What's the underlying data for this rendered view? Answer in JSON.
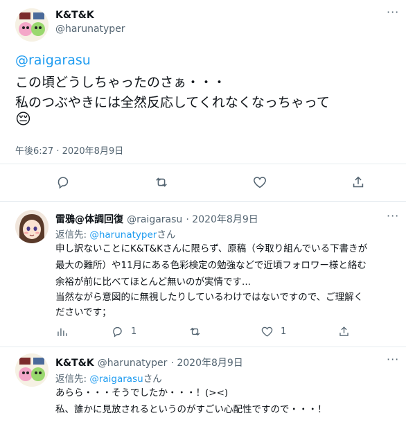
{
  "main_tweet": {
    "author_name": "K&T&K",
    "author_handle": "@harunatyper",
    "mention": "@raigarasu",
    "lines": [
      "この頃どうしちゃったのさぁ・・・",
      "私のつぶやきには全然反応してくれなくなっちゃって"
    ],
    "emoji": "😔",
    "timestamp": "午後6:27 · 2020年8月9日"
  },
  "reply1": {
    "author_name": "雷鴉@体調回復",
    "author_handle": "@raigarasu",
    "date": "2020年8月9日",
    "replying_prefix": "返信先: ",
    "replying_to": "@harunatyper",
    "replying_suffix": "さん",
    "lines": [
      "申し訳ないことにK&T&Kさんに限らず、原稿（今取り組んでいる下書きが",
      "最大の難所）や11月にある色彩検定の勉強などで近頃フォロワー様と絡む",
      "余裕が前に比べてほとんど無いのが実情です...",
      "当然ながら意図的に無視したりしているわけではないですので、ご理解く",
      "ださいです；"
    ],
    "reply_count": "1",
    "like_count": "1"
  },
  "reply2": {
    "author_name": "K&T&K",
    "author_handle": "@harunatyper",
    "date": "2020年8月9日",
    "replying_prefix": "返信先: ",
    "replying_to": "@raigarasu",
    "replying_suffix": "さん",
    "lines": [
      "あらら・・・そうでしたか・・・！(><)",
      "私、誰かに見放されるというのがすごい心配性ですので・・・！"
    ]
  },
  "icons": {
    "reply": "reply-icon",
    "retweet": "retweet-icon",
    "like": "like-icon",
    "share": "share-icon",
    "analytics": "analytics-icon",
    "more": "more-icon"
  },
  "colors": {
    "link": "#1d9bf0",
    "muted": "#536471",
    "divider": "#e6ecf0"
  }
}
